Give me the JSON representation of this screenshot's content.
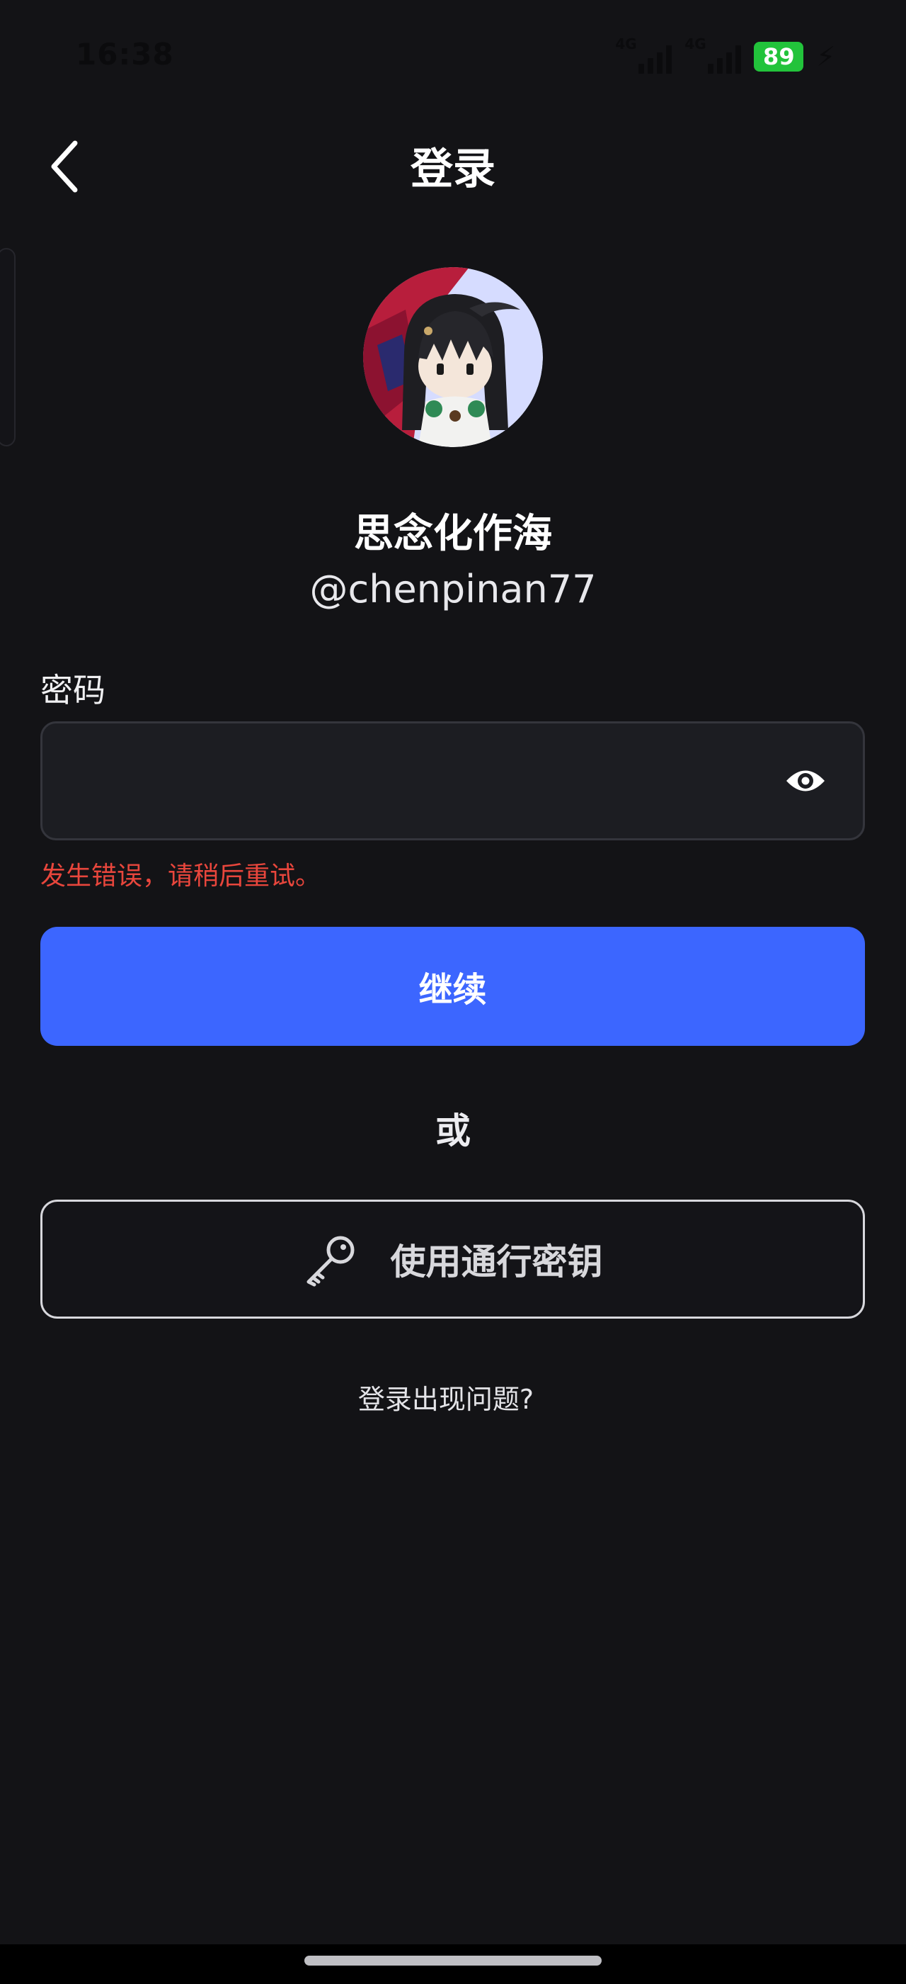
{
  "status_bar": {
    "time": "16:38",
    "network_1": "4G",
    "network_2": "4G",
    "battery": "89",
    "battery_color": "#22c33b"
  },
  "header": {
    "title": "登录",
    "back_icon": "chevron-left-icon"
  },
  "profile": {
    "display_name": "思念化作海",
    "username": "@chenpinan77"
  },
  "password": {
    "label": "密码",
    "value": "",
    "placeholder": "",
    "toggle_icon": "eye-icon",
    "error": "发生错误，请稍后重试。",
    "error_color": "#e8463c"
  },
  "actions": {
    "continue_label": "继续",
    "continue_color": "#3c66ff",
    "or_label": "或",
    "passkey_label": "使用通行密钥",
    "passkey_icon": "key-icon",
    "trouble_link": "登录出现问题?"
  }
}
